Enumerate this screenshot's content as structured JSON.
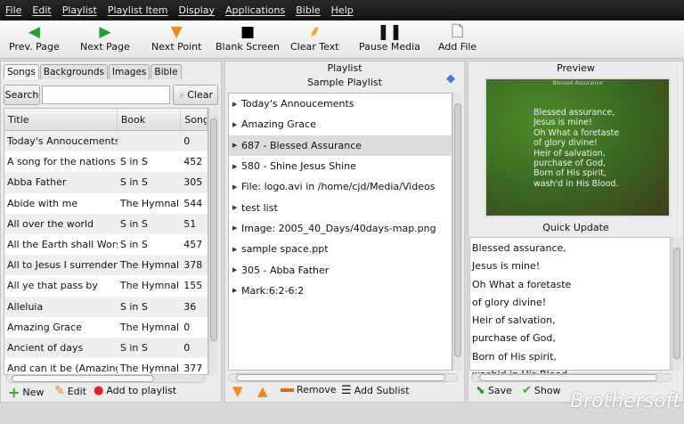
{
  "menu": [
    "File",
    "Edit",
    "Playlist",
    "Playlist Item",
    "Display",
    "Applications",
    "Bible",
    "Help"
  ],
  "toolbar": [
    {
      "label": "Prev. Page",
      "icon": "arrow-left-icon",
      "glyph": "🡐",
      "color": "#1fa12a"
    },
    {
      "label": "Next Page",
      "icon": "arrow-right-icon",
      "glyph": "🡒",
      "color": "#1fa12a"
    },
    {
      "label": "Next Point",
      "icon": "arrow-down-icon",
      "glyph": "🡓",
      "color": "#f08a14"
    },
    {
      "label": "Blank Screen",
      "icon": "square-icon",
      "glyph": "■",
      "color": "#000000"
    },
    {
      "label": "Clear Text",
      "icon": "broom-icon",
      "glyph": "🧹",
      "color": "#e0b020"
    },
    {
      "label": "Pause Media",
      "icon": "pause-icon",
      "glyph": "❚❚",
      "color": "#111111"
    },
    {
      "label": "Add File",
      "icon": "file-icon",
      "glyph": "🗋",
      "color": "#888888"
    }
  ],
  "songs": {
    "tabs": [
      "Songs",
      "Backgrounds",
      "Images",
      "Bible"
    ],
    "search_label": "Search",
    "search_value": "",
    "clear_label": "Clear",
    "columns": [
      "Title",
      "Book",
      "Song"
    ],
    "rows": [
      [
        "Today's Annoucements",
        "",
        "0"
      ],
      [
        "A song for the nations",
        "S in S",
        "452"
      ],
      [
        "Abba Father",
        "S in S",
        "305"
      ],
      [
        "Abide with me",
        "The Hymnal",
        "544"
      ],
      [
        "All over the world",
        "S in S",
        "51"
      ],
      [
        "All the Earth shall Worship",
        "S in S",
        "457"
      ],
      [
        "All to Jesus I surrender",
        "The Hymnal",
        "378"
      ],
      [
        "All ye that pass by",
        "The Hymnal",
        "155"
      ],
      [
        "Alleluia",
        "S in S",
        "36"
      ],
      [
        "Amazing Grace",
        "The Hymnal",
        "0"
      ],
      [
        "Ancient of days",
        "S in S",
        "0"
      ],
      [
        "And can it be (Amazing Love)",
        "The Hymnal",
        "377"
      ]
    ],
    "buttons": [
      "New",
      "Edit",
      "Add to playlist"
    ]
  },
  "playlist": {
    "title": "Playlist",
    "name": "Sample Playlist",
    "items": [
      "Today's Annoucements",
      "Amazing Grace",
      "687 - Blessed Assurance",
      "580 - Shine Jesus Shine",
      "File: logo.avi in /home/cjd/Media/Videos",
      "test list",
      "Image: 2005_40_Days/40days-map.png",
      "sample space.ppt",
      "305 - Abba Father",
      "Mark:6:2-6:2"
    ],
    "selected": 2,
    "buttons": [
      "Remove",
      "Add Sublist"
    ]
  },
  "preview": {
    "title": "Preview",
    "slide_header": "Blessed Assurance",
    "slide_lines": [
      "Blessed assurance,",
      "Jesus is mine!",
      "Oh What a foretaste",
      "of glory divine!",
      "Heir of salvation,",
      "purchase of God,",
      "Born of His spirit,",
      "wash'd in His Blood."
    ],
    "quick_update_title": "Quick Update",
    "quick_lines": [
      "Blessed assurance,",
      "Jesus is mine!",
      "Oh What a foretaste",
      "of glory divine!",
      "Heir of salvation,",
      "purchase of God,",
      "Born of His spirit,",
      "wash'd in His Blood."
    ],
    "buttons": [
      "Save",
      "Show"
    ]
  },
  "watermark": "Brothersoft"
}
